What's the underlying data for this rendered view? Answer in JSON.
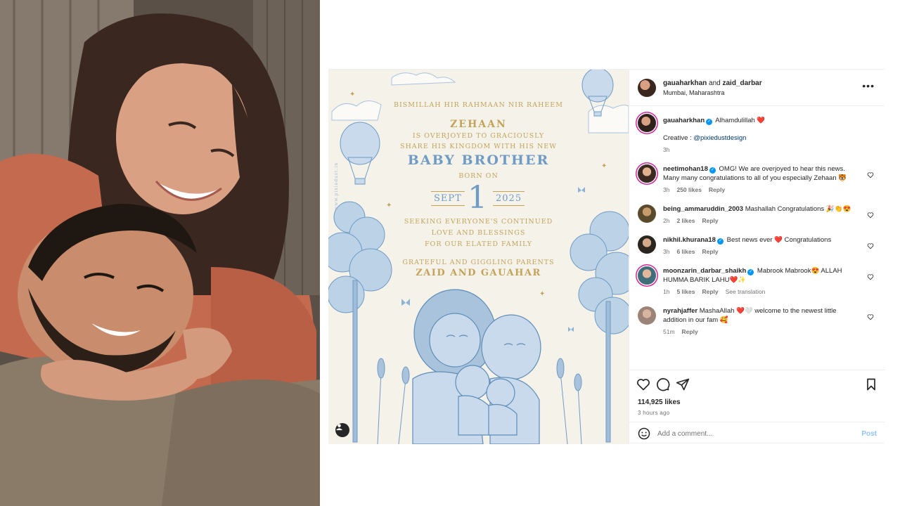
{
  "post": {
    "header": {
      "user1": "gauaharkhan",
      "joiner": "and",
      "user2": "zaid_darbar",
      "location": "Mumbai, Maharashtra",
      "more_icon": "more-horizontal-icon"
    },
    "invitation": {
      "line1": "BISMILLAH HIR  RAHMAAN NIR RAHEEM",
      "name": "ZEHAAN",
      "line2": "IS OVERJOYED TO GRACIOUSLY",
      "line3": "SHARE HIS KINGDOM WITH HIS NEW",
      "headline": "BABY BROTHER",
      "born": "BORN ON",
      "month": "SEPT",
      "day": "1",
      "year": "2025",
      "line4": "SEEKING EVERYONE'S CONTINUED",
      "line5": "LOVE AND BLESSINGS",
      "line6": "FOR OUR ELATED FAMILY",
      "line7": "GRATEFUL AND GIGGLING PARENTS",
      "parents": "ZAID AND GAUAHAR",
      "watermark": "www.pixiedust.in"
    },
    "caption": {
      "user": "gauaharkhan",
      "text": "Alhamdulillah ❤️",
      "credit_label": "Creative :",
      "credit_link": "@pixiedustdesign",
      "time": "3h"
    },
    "comments": [
      {
        "user": "neetimohan18",
        "verified": true,
        "text": "OMG! We are overjoyed to hear this news. Many many congratulations to all of you especially Zehaan 🐯",
        "time": "3h",
        "likes": "250 likes",
        "reply": "Reply",
        "extra": ""
      },
      {
        "user": "being_ammaruddin_2003",
        "verified": false,
        "text": "Mashallah Congratulations 🎉👏😍",
        "time": "2h",
        "likes": "2 likes",
        "reply": "Reply",
        "extra": ""
      },
      {
        "user": "nikhil.khurana18",
        "verified": true,
        "text": "Best news ever ❤️ Congratulations",
        "time": "3h",
        "likes": "6 likes",
        "reply": "Reply",
        "extra": ""
      },
      {
        "user": "moonzarin_darbar_shaikh",
        "verified": true,
        "text": "Mabrook Mabrook😍 ALLAH HUMMA BARIK LAHU❤️✨",
        "time": "1h",
        "likes": "5 likes",
        "reply": "Reply",
        "extra": "See translation"
      },
      {
        "user": "nyrahjaffer",
        "verified": false,
        "text": "MashaAllah ❤️🤍 welcome to the newest little addition in our fam 🥰",
        "time": "51m",
        "likes": "",
        "reply": "Reply",
        "extra": ""
      }
    ],
    "actions": {
      "likes": "114,925 likes",
      "time": "3 hours ago",
      "comment_placeholder": "Add a comment...",
      "post_label": "Post"
    }
  }
}
